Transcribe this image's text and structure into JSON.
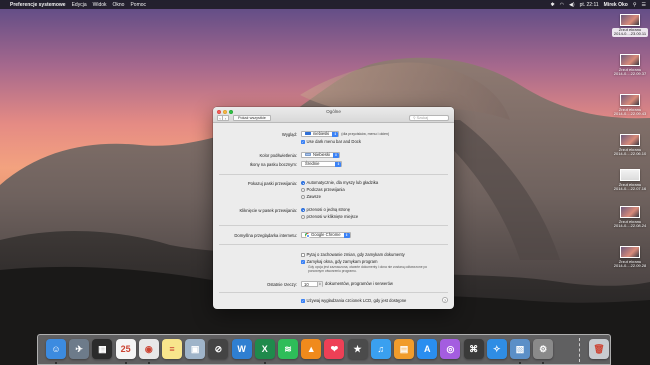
{
  "menubar": {
    "app_name": "Preferencje systemowe",
    "menus": [
      "Edycja",
      "Widok",
      "Okno",
      "Pomoc"
    ],
    "clock": "pt. 22:11",
    "user": "Mirek Oko"
  },
  "desktop_files": [
    {
      "line1": "Zrzut ekranu",
      "line2": "2014-0....23.00.11"
    },
    {
      "line1": "Zrzut ekranu",
      "line2": "2014-0....22.09.37"
    },
    {
      "line1": "Zrzut ekranu",
      "line2": "2014-0....22.09.43"
    },
    {
      "line1": "Zrzut ekranu",
      "line2": "2014-0....22.06.10"
    },
    {
      "line1": "Zrzut ekranu",
      "line2": "2014-0....22.07.16"
    },
    {
      "line1": "Zrzut ekranu",
      "line2": "2014-0....22.08.24"
    },
    {
      "line1": "Zrzut ekranu",
      "line2": "2014-0....22.09.28"
    }
  ],
  "window": {
    "title": "Ogólne",
    "show_all": "Pokaż wszystkie",
    "search_placeholder": "Szukaj",
    "appearance": {
      "label": "Wygląd:",
      "value": "niebieski",
      "hint": "(dla przycisków, menu i okien)",
      "dark_menu": "Use dark menu bar and Dock",
      "color": "#2f6fd6"
    },
    "highlight": {
      "label": "Kolor podświetlenia:",
      "value": "Niebieski",
      "color": "#a9c4ec"
    },
    "sidebar_icons": {
      "label": "Ikony na pasku bocznym:",
      "value": "Średnie"
    },
    "scrollbars": {
      "label": "Pokazuj paski przewijania:",
      "options": [
        "Automatycznie, dla myszy lub gładzika",
        "Podczas przewijania",
        "Zawsze"
      ],
      "selected": 0
    },
    "scroll_click": {
      "label": "Kliknięcie w pasek przewijania:",
      "options": [
        "przenosi o jedną stronę",
        "przenosi w kliknięte miejsce"
      ],
      "selected": 0
    },
    "browser": {
      "label": "Domyślna przeglądarka internetu:",
      "value": "Google Chrome"
    },
    "documents": {
      "ask_save": "Pytaj o zachowanie zmian, gdy zamykam dokumenty",
      "close_windows": "Zamykaj okna, gdy zamykam program",
      "note": "Gdy opcja jest zaznaczona, otwarte dokumenty i okna nie zostaną odtworzone po ponownym otworzeniu programu."
    },
    "recent": {
      "label": "Ostatnie rzeczy:",
      "value": "10",
      "suffix": "dokumentów, programów i serwerów"
    },
    "lcd_smoothing": "Używaj wygładzania czcionek LCD, gdy jest dostępne",
    "help": "?"
  },
  "dock": {
    "apps": [
      {
        "name": "finder",
        "glyph": "☺",
        "color": "#3c8be0"
      },
      {
        "name": "launchpad",
        "glyph": "✈",
        "color": "#6d7b8a"
      },
      {
        "name": "mission-control",
        "glyph": "▦",
        "color": "#2b2b2b"
      },
      {
        "name": "calendar",
        "glyph": "25",
        "color": "#f5f5f5"
      },
      {
        "name": "chrome",
        "glyph": "◉",
        "color": "#e8e8e8"
      },
      {
        "name": "notes",
        "glyph": "≡",
        "color": "#f8e58c"
      },
      {
        "name": "preview",
        "glyph": "▣",
        "color": "#9fb4c9"
      },
      {
        "name": "no-entry",
        "glyph": "⊘",
        "color": "#444444"
      },
      {
        "name": "word",
        "glyph": "W",
        "color": "#2f7fd1"
      },
      {
        "name": "excel",
        "glyph": "X",
        "color": "#1f8a4c"
      },
      {
        "name": "spotify",
        "glyph": "≋",
        "color": "#2ebd59"
      },
      {
        "name": "vlc",
        "glyph": "▲",
        "color": "#f08a1c"
      },
      {
        "name": "pocket",
        "glyph": "❤",
        "color": "#ee4056"
      },
      {
        "name": "imovie-star",
        "glyph": "★",
        "color": "#4b4b4b"
      },
      {
        "name": "itunes",
        "glyph": "♫",
        "color": "#3aa0f0"
      },
      {
        "name": "ibooks",
        "glyph": "▤",
        "color": "#f19c2b"
      },
      {
        "name": "app-store",
        "glyph": "A",
        "color": "#2a8ef0"
      },
      {
        "name": "podcasts",
        "glyph": "◎",
        "color": "#a45de0"
      },
      {
        "name": "acrobat",
        "glyph": "⌘",
        "color": "#3a3a3a"
      },
      {
        "name": "safari",
        "glyph": "✧",
        "color": "#2f8de4"
      },
      {
        "name": "photo",
        "glyph": "▧",
        "color": "#5b8fc7"
      },
      {
        "name": "system-preferences",
        "glyph": "⚙",
        "color": "#8a8a8a"
      },
      {
        "name": "trash",
        "glyph": "🗑",
        "color": "#c8ccd0"
      }
    ]
  }
}
